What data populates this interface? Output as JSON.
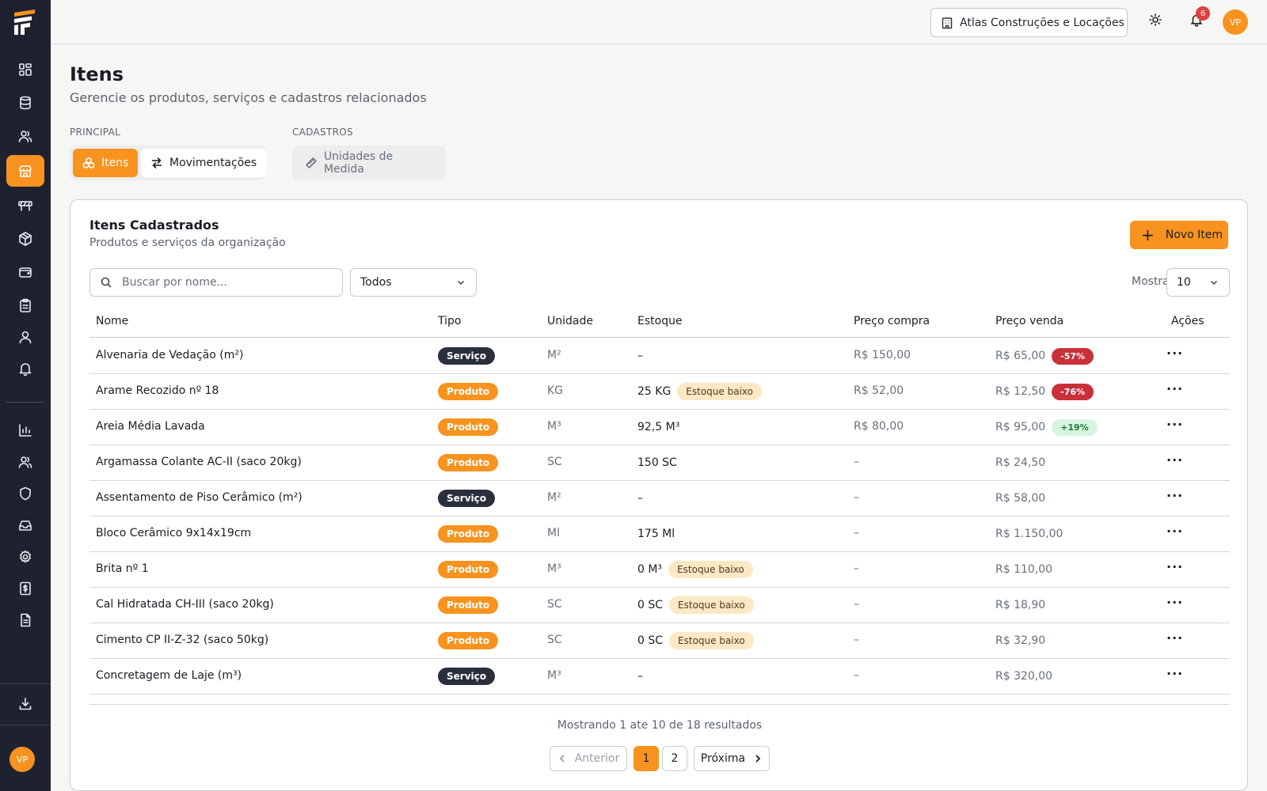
{
  "org": {
    "name": "Atlas Construções e Locações"
  },
  "notifications": {
    "count": "6"
  },
  "user": {
    "initials": "VP"
  },
  "header": {
    "title": "Itens",
    "subtitle": "Gerencie os produtos, serviços e cadastros relacionados"
  },
  "sections": {
    "principal": "PRINCIPAL",
    "cadastros": "CADASTROS"
  },
  "tabs": {
    "itens": "Itens",
    "movimentacoes": "Movimentações",
    "unidades": "Unidades de Medida"
  },
  "card": {
    "title": "Itens Cadastrados",
    "subtitle": "Produtos e serviços da organização",
    "new_button": "Novo Item",
    "search_placeholder": "Buscar por nome...",
    "filter_value": "Todos",
    "show_label": "Mostrar:",
    "show_value": "10"
  },
  "table": {
    "headers": {
      "nome": "Nome",
      "tipo": "Tipo",
      "unidade": "Unidade",
      "estoque": "Estoque",
      "compra": "Preço compra",
      "venda": "Preço venda",
      "acoes": "Ações"
    },
    "rows": [
      {
        "name": "Alvenaria de Vedação (m²)",
        "type": "Serviço",
        "unit": "M²",
        "stock": "–",
        "stock_low": "",
        "buy": "R$ 150,00",
        "sell": "R$ 65,00",
        "pct": "-57%",
        "actions": "···"
      },
      {
        "name": "Arame Recozido nº 18",
        "type": "Produto",
        "unit": "KG",
        "stock": "25 KG",
        "stock_low": "Estoque baixo",
        "buy": "R$ 52,00",
        "sell": "R$ 12,50",
        "pct": "-76%",
        "actions": "···"
      },
      {
        "name": "Areia Média Lavada",
        "type": "Produto",
        "unit": "M³",
        "stock": "92,5 M³",
        "stock_low": "",
        "buy": "R$ 80,00",
        "sell": "R$ 95,00",
        "pct": "+19%",
        "actions": "···"
      },
      {
        "name": "Argamassa Colante AC-II (saco 20kg)",
        "type": "Produto",
        "unit": "SC",
        "stock": "150 SC",
        "stock_low": "",
        "buy": "–",
        "sell": "R$ 24,50",
        "pct": "",
        "actions": "···"
      },
      {
        "name": "Assentamento de Piso Cerâmico (m²)",
        "type": "Serviço",
        "unit": "M²",
        "stock": "–",
        "stock_low": "",
        "buy": "–",
        "sell": "R$ 58,00",
        "pct": "",
        "actions": "···"
      },
      {
        "name": "Bloco Cerâmico 9x14x19cm",
        "type": "Produto",
        "unit": "Ml",
        "stock": "175 Ml",
        "stock_low": "",
        "buy": "–",
        "sell": "R$ 1.150,00",
        "pct": "",
        "actions": "···"
      },
      {
        "name": "Brita nº 1",
        "type": "Produto",
        "unit": "M³",
        "stock": "0 M³",
        "stock_low": "Estoque baixo",
        "buy": "–",
        "sell": "R$ 110,00",
        "pct": "",
        "actions": "···"
      },
      {
        "name": "Cal Hidratada CH-III (saco 20kg)",
        "type": "Produto",
        "unit": "SC",
        "stock": "0 SC",
        "stock_low": "Estoque baixo",
        "buy": "–",
        "sell": "R$ 18,90",
        "pct": "",
        "actions": "···"
      },
      {
        "name": "Cimento CP II-Z-32 (saco 50kg)",
        "type": "Produto",
        "unit": "SC",
        "stock": "0 SC",
        "stock_low": "Estoque baixo",
        "buy": "–",
        "sell": "R$ 32,90",
        "pct": "",
        "actions": "···"
      },
      {
        "name": "Concretagem de Laje (m³)",
        "type": "Serviço",
        "unit": "M³",
        "stock": "–",
        "stock_low": "",
        "buy": "–",
        "sell": "R$ 320,00",
        "pct": "",
        "actions": "···"
      }
    ]
  },
  "pagination": {
    "summary": "Mostrando 1 ate 10 de 18 resultados",
    "prev": "Anterior",
    "page1": "1",
    "page2": "2",
    "next": "Próxima"
  },
  "colors": {
    "accent": "#f7931e",
    "sidebar": "#1e2230",
    "negative": "#c9303a",
    "positive": "#d6f5df",
    "low_stock": "#fde8c4"
  }
}
